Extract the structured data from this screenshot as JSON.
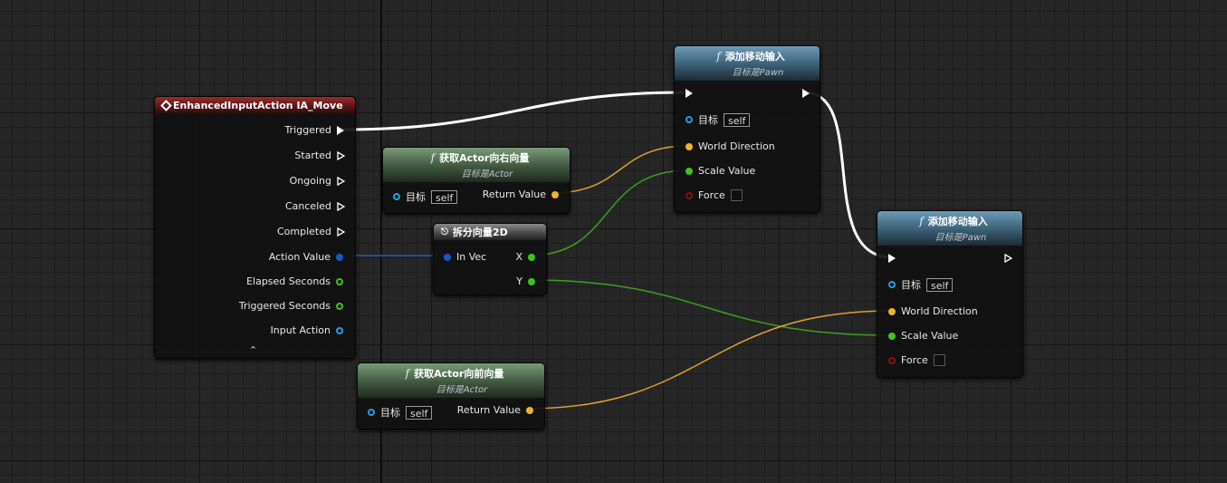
{
  "colors": {
    "exec": "#ffffff",
    "vector": "#f2b12d",
    "float": "#3fc41c",
    "object": "#1fa0e8",
    "struct": "#1a58c8",
    "bool": "#8a1010",
    "wire_struct": "#2a5ab8"
  },
  "nodes": {
    "enhanced": {
      "title": "EnhancedInputAction IA_Move",
      "pins": {
        "triggered": "Triggered",
        "started": "Started",
        "ongoing": "Ongoing",
        "canceled": "Canceled",
        "completed": "Completed",
        "action_value": "Action Value",
        "elapsed": "Elapsed Seconds",
        "triggered_seconds": "Triggered Seconds",
        "input_action": "Input Action"
      },
      "collapse_glyph": "⌃"
    },
    "add_move_1": {
      "title": "添加移动输入",
      "subtitle": "目标是Pawn",
      "target_label": "目标",
      "target_value": "self",
      "world_direction": "World Direction",
      "scale_value": "Scale Value",
      "force": "Force"
    },
    "add_move_2": {
      "title": "添加移动输入",
      "subtitle": "目标是Pawn",
      "target_label": "目标",
      "target_value": "self",
      "world_direction": "World Direction",
      "scale_value": "Scale Value",
      "force": "Force"
    },
    "get_right": {
      "title": "获取Actor向右向量",
      "subtitle": "目标是Actor",
      "target_label": "目标",
      "target_value": "self",
      "return_value": "Return Value"
    },
    "get_forward": {
      "title": "获取Actor向前向量",
      "subtitle": "目标是Actor",
      "target_label": "目标",
      "target_value": "self",
      "return_value": "Return Value"
    },
    "break_vector": {
      "title": "拆分向量2D",
      "in_vec": "In Vec",
      "x": "X",
      "y": "Y"
    }
  },
  "icons": {
    "function": "f",
    "event": "diamond-event-icon",
    "break": "break-struct-icon"
  }
}
